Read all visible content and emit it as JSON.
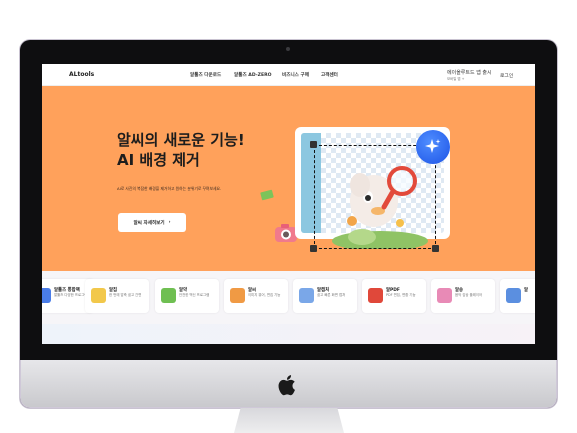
{
  "nav": {
    "logo": "ALtools",
    "menu": [
      "알툴즈 다운로드",
      "알툴즈 AD-ZERO",
      "비즈니스 구매",
      "고객센터"
    ],
    "right_title": "에이올루트드 앱 출시",
    "right_sub": "모바일 앱 +",
    "login": "로그인"
  },
  "hero": {
    "title_line1": "알씨의 새로운 기능!",
    "title_line2": "AI 배경 제거",
    "desc": "AI로 사진의 복잡한 배경을 제거하고 원하는 분위기로 꾸며보세요.",
    "button_label": "알씨 자세히보기",
    "button_arrow": "›",
    "bg_color": "#ffa15b"
  },
  "tools": [
    {
      "name": "알툴즈 통합팩",
      "desc": "알툴즈 다양한 프로그램",
      "icon_color": "#4a7de8"
    },
    {
      "name": "알집",
      "desc": "한 번에 압축 쉽고 간편",
      "icon_color": "#f2c84b"
    },
    {
      "name": "알약",
      "desc": "안전한 백신 프로그램",
      "icon_color": "#6fbf52"
    },
    {
      "name": "알씨",
      "desc": "이미지 뷰어, 편집 기능",
      "icon_color": "#f09a44"
    },
    {
      "name": "알캡처",
      "desc": "쉽고 빠른 화면 캡처",
      "icon_color": "#7aa7e8"
    },
    {
      "name": "알PDF",
      "desc": "PDF 편집, 변환 기능",
      "icon_color": "#e0483a"
    },
    {
      "name": "알송",
      "desc": "음악 감상 플레이어",
      "icon_color": "#e88ab6"
    },
    {
      "name": "알",
      "desc": "",
      "icon_color": "#5b8fe0"
    }
  ]
}
